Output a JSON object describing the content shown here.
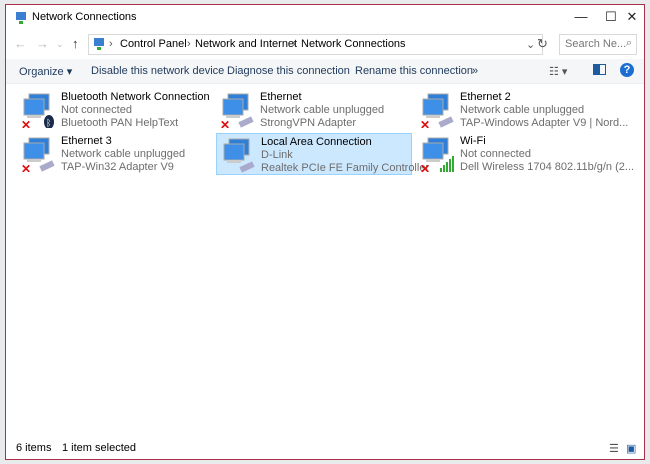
{
  "window": {
    "title": "Network Connections"
  },
  "address": {
    "crumbs": [
      "Control Panel",
      "Network and Internet",
      "Network Connections"
    ],
    "search_placeholder": "Search Ne..."
  },
  "toolbar": {
    "organize": "Organize ▾",
    "disable": "Disable this network device",
    "diagnose": "Diagnose this connection",
    "rename": "Rename this connection",
    "more": "»"
  },
  "items": [
    {
      "name": "Bluetooth Network Connection",
      "status": "Not connected",
      "device": "Bluetooth PAN HelpText",
      "badge": "bluetooth"
    },
    {
      "name": "Ethernet",
      "status": "Network cable unplugged",
      "device": "StrongVPN Adapter",
      "badge": "cable"
    },
    {
      "name": "Ethernet 2",
      "status": "Network cable unplugged",
      "device": "TAP-Windows Adapter V9 | Nord...",
      "badge": "cable"
    },
    {
      "name": "Ethernet 3",
      "status": "Network cable unplugged",
      "device": "TAP-Win32 Adapter V9",
      "badge": "cable"
    },
    {
      "name": "Local Area Connection",
      "status": "D-Link",
      "device": "Realtek PCIe FE Family Controller",
      "badge": "cable"
    },
    {
      "name": "Wi-Fi",
      "status": "Not connected",
      "device": "Dell Wireless 1704 802.11b/g/n (2...",
      "badge": "wifi"
    }
  ],
  "statusbar": {
    "count": "6 items",
    "selected": "1 item selected"
  }
}
